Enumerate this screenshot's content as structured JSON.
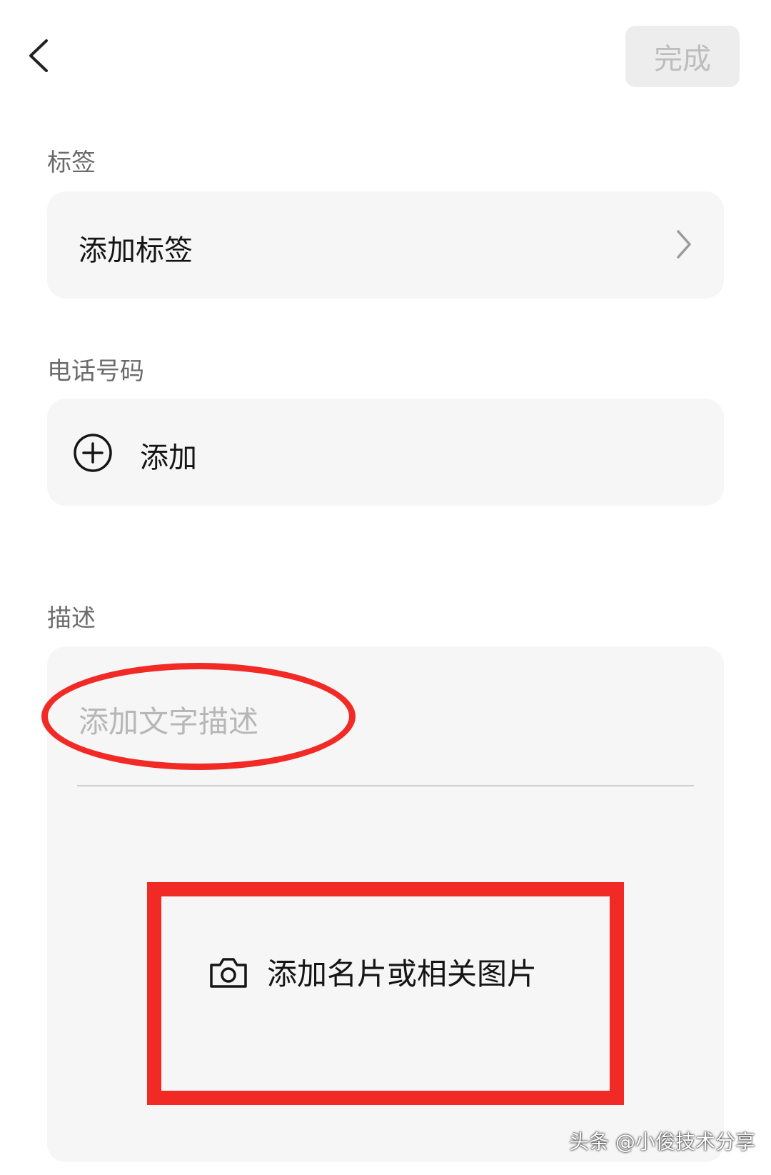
{
  "header": {
    "done_label": "完成"
  },
  "tags": {
    "section_label": "标签",
    "add_label": "添加标签"
  },
  "phone": {
    "section_label": "电话号码",
    "add_label": "添加"
  },
  "description": {
    "section_label": "描述",
    "placeholder": "添加文字描述",
    "add_image_label": "添加名片或相关图片"
  },
  "watermark": "头条 @小俊技术分享",
  "colors": {
    "annotation_red": "#f22a25",
    "card_bg": "#f6f6f6",
    "done_bg": "#ededed"
  },
  "icons": [
    "back-arrow-icon",
    "chevron-right-icon",
    "plus-circle-icon",
    "camera-icon"
  ]
}
